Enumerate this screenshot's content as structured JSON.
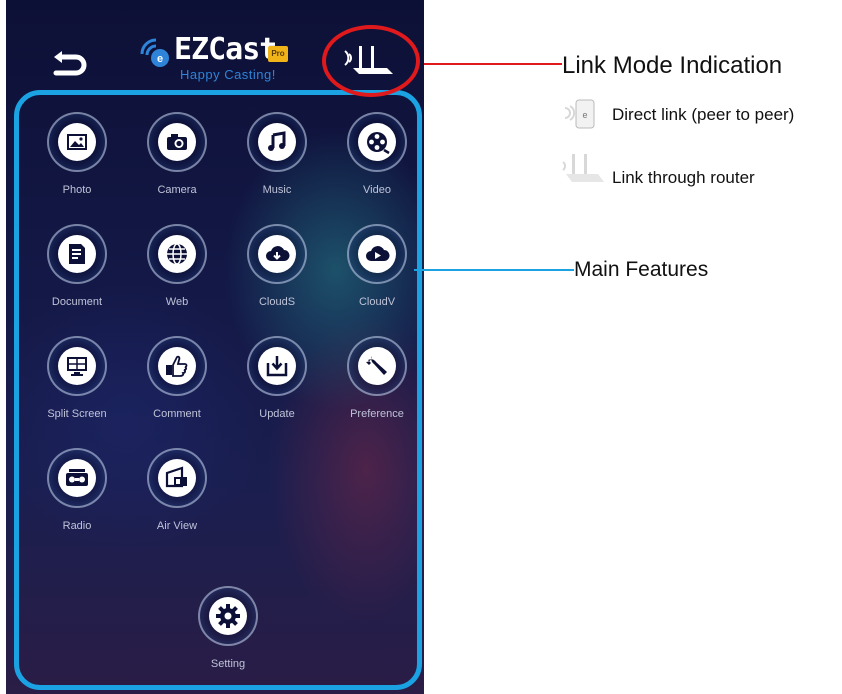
{
  "app": {
    "logo_text": "EZCast",
    "logo_badge": "Pro",
    "tagline": "Happy Casting!",
    "back_icon": "back-arrow-icon",
    "link_mode_icon": "router-link-icon"
  },
  "features": [
    {
      "label": "Photo",
      "icon": "photo-icon"
    },
    {
      "label": "Camera",
      "icon": "camera-icon"
    },
    {
      "label": "Music",
      "icon": "music-icon"
    },
    {
      "label": "Video",
      "icon": "video-reel-icon"
    },
    {
      "label": "Document",
      "icon": "document-icon"
    },
    {
      "label": "Web",
      "icon": "globe-icon"
    },
    {
      "label": "CloudS",
      "icon": "cloud-download-icon"
    },
    {
      "label": "CloudV",
      "icon": "cloud-play-icon"
    },
    {
      "label": "Split Screen",
      "icon": "monitor-split-icon"
    },
    {
      "label": "Comment",
      "icon": "thumbs-up-icon"
    },
    {
      "label": "Update",
      "icon": "download-box-icon"
    },
    {
      "label": "Preference",
      "icon": "wrench-icon"
    },
    {
      "label": "Radio",
      "icon": "radio-icon"
    },
    {
      "label": "Air View",
      "icon": "air-view-icon"
    }
  ],
  "setting": {
    "label": "Setting",
    "icon": "gear-icon"
  },
  "annotations": {
    "link_mode_title": "Link Mode Indication",
    "direct_link": "Direct link (peer to peer)",
    "router_link": "Link through router",
    "main_features": "Main Features"
  },
  "colors": {
    "link_mode_highlight": "#e0191c",
    "features_highlight": "#1aa2e2",
    "app_background": "#131846",
    "logo_accent": "#2e84d8"
  }
}
